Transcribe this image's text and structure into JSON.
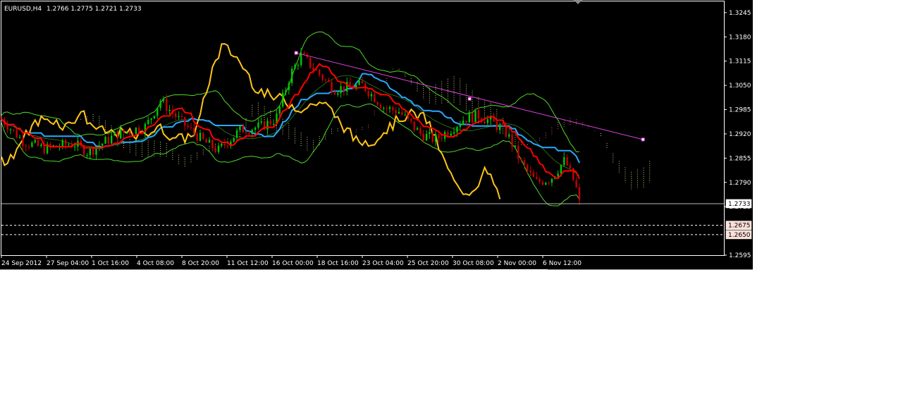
{
  "header": {
    "symbol_tf": "EURUSD,H4",
    "ohlc": "1.2766 1.2775 1.2721 1.2733"
  },
  "chart_data": {
    "type": "candlestick",
    "symbol": "EURUSD",
    "timeframe": "H4",
    "last_bar": {
      "open": 1.2766,
      "high": 1.2775,
      "low": 1.2721,
      "close": 1.2733
    },
    "ylim": [
      1.2595,
      1.3275
    ],
    "y_ticks": [
      "1.3245",
      "1.3180",
      "1.3115",
      "1.3050",
      "1.2985",
      "1.2920",
      "1.2855",
      "1.2790",
      "1.2725",
      "1.2595"
    ],
    "x_ticks": [
      "24 Sep 2012",
      "27 Sep 04:00",
      "1 Oct 16:00",
      "4 Oct 08:00",
      "8 Oct 20:00",
      "11 Oct 12:00",
      "16 Oct 00:00",
      "18 Oct 16:00",
      "23 Oct 04:00",
      "25 Oct 20:00",
      "30 Oct 08:00",
      "2 Nov 00:00",
      "6 Nov 12:00"
    ],
    "current_price": {
      "label": "1.2733",
      "value": 1.2733
    },
    "levels": [
      {
        "label": "1.2675",
        "value": 1.2675
      },
      {
        "label": "1.2650",
        "value": 1.265
      }
    ],
    "trendline": {
      "from": {
        "bar": 0.408,
        "price": 1.3137
      },
      "mid": {
        "bar": 0.648,
        "price": 1.3014
      },
      "to": {
        "bar": 0.888,
        "price": 1.2905
      }
    },
    "grid": false,
    "colors": {
      "background": "#000000",
      "bull": "#00c800",
      "bear": "#c80000",
      "tenkan": "#ff0000",
      "kijun": "#2aa8ff",
      "chikou": "#ffc61a",
      "bollinger": "#4fd62a",
      "kumo_bull": "#c8d77a",
      "kumo_bear": "#d06060",
      "trendline": "#e040e0",
      "axis_text": "#ffffff"
    }
  }
}
